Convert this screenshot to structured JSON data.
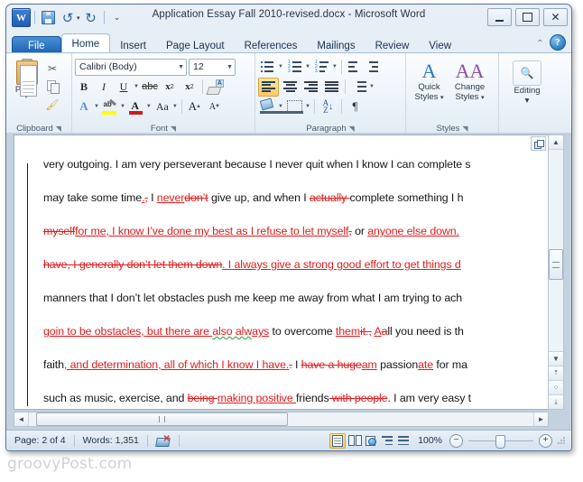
{
  "window": {
    "title": "Application Essay Fall 2010-revised.docx  -  Microsoft Word",
    "app_logo": "W",
    "quick_access": [
      {
        "name": "save-icon",
        "label": "Save"
      },
      {
        "name": "undo-icon",
        "label": "↺"
      },
      {
        "name": "redo-icon",
        "label": "↻"
      },
      {
        "name": "customize-qat-icon",
        "label": "▾"
      }
    ],
    "controls": {
      "minimize": "–",
      "restore": "❐",
      "close": "✕"
    }
  },
  "tabs": [
    {
      "id": "file",
      "label": "File",
      "active": false
    },
    {
      "id": "home",
      "label": "Home",
      "active": true
    },
    {
      "id": "insert",
      "label": "Insert",
      "active": false
    },
    {
      "id": "page-layout",
      "label": "Page Layout",
      "active": false
    },
    {
      "id": "references",
      "label": "References",
      "active": false
    },
    {
      "id": "mailings",
      "label": "Mailings",
      "active": false
    },
    {
      "id": "review",
      "label": "Review",
      "active": false
    },
    {
      "id": "view",
      "label": "View",
      "active": false
    }
  ],
  "tab_right": {
    "minimize_ribbon": "⌃",
    "help": "?"
  },
  "ribbon": {
    "clipboard": {
      "label": "Clipboard",
      "paste_label": "Paste",
      "paste_arrow": "▾",
      "cut_label": "Cut",
      "copy_label": "Copy",
      "format_painter_label": "Format Painter",
      "dialog_launcher": "◥"
    },
    "font": {
      "label": "Font",
      "font_name": "Calibri (Body)",
      "font_size": "12",
      "bold": "B",
      "italic": "I",
      "underline": "U",
      "strikethrough": "abc",
      "subscript": "x",
      "superscript": "x",
      "clear_formatting": "Clear Formatting",
      "text_effects": "A",
      "highlight": "ab",
      "font_color": "A",
      "change_case": "Aa",
      "grow_font": "A",
      "shrink_font": "A",
      "dialog_launcher": "◥"
    },
    "paragraph": {
      "label": "Paragraph",
      "bullets": "Bullets",
      "numbering": "Numbering",
      "multilevel": "Multilevel List",
      "decrease_indent": "Decrease Indent",
      "increase_indent": "Increase Indent",
      "align_left": "Align Left",
      "align_center": "Center",
      "align_right": "Align Right",
      "justify": "Justify",
      "line_spacing": "Line Spacing",
      "shading": "Shading",
      "borders": "Borders",
      "sort": "Sort",
      "show_marks": "¶",
      "dialog_launcher": "◥"
    },
    "styles": {
      "label": "Styles",
      "quick_styles_line1": "Quick",
      "quick_styles_line2": "Styles",
      "change_styles_line1": "Change",
      "change_styles_line2": "Styles",
      "arrow": "▾",
      "dialog_launcher": "◥"
    },
    "editing": {
      "label": "Editing",
      "editing_label": "Editing",
      "arrow": "▾"
    }
  },
  "document": {
    "lines": [
      {
        "id": "line-1",
        "segments": [
          {
            "text": "very outgoing. I am very perseverant because I never quit when I know I can complete s",
            "style": "normal"
          }
        ]
      },
      {
        "id": "line-2",
        "segments": [
          {
            "text": "may take some time",
            "style": "normal"
          },
          {
            "text": ".",
            "style": "insert"
          },
          {
            "text": ",",
            "style": "delete"
          },
          {
            "text": " I ",
            "style": "normal"
          },
          {
            "text": "never",
            "style": "insert"
          },
          {
            "text": "don’t",
            "style": "delete"
          },
          {
            "text": " give up, and when I ",
            "style": "normal"
          },
          {
            "text": "actually ",
            "style": "delete"
          },
          {
            "text": "complete something I h",
            "style": "normal"
          }
        ]
      },
      {
        "id": "line-3",
        "segments": [
          {
            "text": "myself",
            "style": "delete"
          },
          {
            "text": "for me, I know I’ve done my best as I refuse to let myself",
            "style": "insert"
          },
          {
            "text": ",",
            "style": "delete"
          },
          {
            "text": " or ",
            "style": "normal"
          },
          {
            "text": "anyone else down. ",
            "style": "insert"
          }
        ]
      },
      {
        "id": "line-4",
        "segments": [
          {
            "text": "have, I generally don’t let them down",
            "style": "delete"
          },
          {
            "text": ". I always give a strong good effort to get things d",
            "style": "normal"
          }
        ]
      },
      {
        "id": "line-5",
        "segments": [
          {
            "text": "manners that I don’t let obstacles push me keep me away from what I am trying to ach",
            "style": "normal"
          }
        ]
      },
      {
        "id": "line-6",
        "segments": [
          {
            "text": "goin to be obstacles, but there are ",
            "style": "insert"
          },
          {
            "text": "also  alw",
            "style": "insert-grammar"
          },
          {
            "text": "ays",
            "style": "insert"
          },
          {
            "text": " to overcome ",
            "style": "normal"
          },
          {
            "text": "them",
            "style": "insert"
          },
          {
            "text": "it.",
            "style": "delete"
          },
          {
            "text": ",",
            "style": "delete"
          },
          {
            "text": " ",
            "style": "normal"
          },
          {
            "text": "A",
            "style": "insert"
          },
          {
            "text": "a",
            "style": "delete"
          },
          {
            "text": "ll you need is th",
            "style": "normal"
          }
        ]
      },
      {
        "id": "line-7",
        "segments": [
          {
            "text": "faith",
            "style": "normal"
          },
          {
            "text": ", and determination, all of which I know I have.",
            "style": "insert"
          },
          {
            "text": ".",
            "style": "delete"
          },
          {
            "text": " I ",
            "style": "normal"
          },
          {
            "text": "have a huge",
            "style": "delete"
          },
          {
            "text": "am",
            "style": "insert"
          },
          {
            "text": " passion",
            "style": "normal"
          },
          {
            "text": "ate",
            "style": "insert"
          },
          {
            "text": " for ma",
            "style": "normal"
          }
        ]
      },
      {
        "id": "line-8",
        "segments": [
          {
            "text": "such as music, exercise, and ",
            "style": "normal"
          },
          {
            "text": "being ",
            "style": "delete"
          },
          {
            "text": "making positive ",
            "style": "insert"
          },
          {
            "text": "friends",
            "style": "normal"
          },
          {
            "text": " with people",
            "style": "delete"
          },
          {
            "text": ". I am very easy t",
            "style": "normal"
          }
        ]
      }
    ]
  },
  "status": {
    "page": "Page: 2 of 4",
    "words": "Words: 1,351",
    "proofing_icon": "proofing-errors-icon",
    "zoom_level": "100%",
    "zoom_out": "−",
    "zoom_in": "+",
    "views": [
      {
        "id": "print-layout",
        "label": "Print Layout",
        "active": true
      },
      {
        "id": "full-screen-reading",
        "label": "Full Screen Reading",
        "active": false
      },
      {
        "id": "web-layout",
        "label": "Web Layout",
        "active": false
      },
      {
        "id": "outline",
        "label": "Outline",
        "active": false
      },
      {
        "id": "draft",
        "label": "Draft",
        "active": false
      }
    ]
  },
  "scrollbars": {
    "up_arrow": "▲",
    "down_arrow": "▼",
    "left_arrow": "◄",
    "right_arrow": "►",
    "prev_page": "⤒",
    "select_browse_object": "○",
    "next_page": "⤓"
  },
  "watermark": "groovyPost.com",
  "colors": {
    "accent_blue": "#1d5fb4",
    "revision_red": "#e11b1b",
    "grammar_green": "#2e9b3f",
    "highlight_yellow": "#ffff00",
    "font_color_red": "#d31a1a",
    "active_toggle": "#ffc963"
  }
}
